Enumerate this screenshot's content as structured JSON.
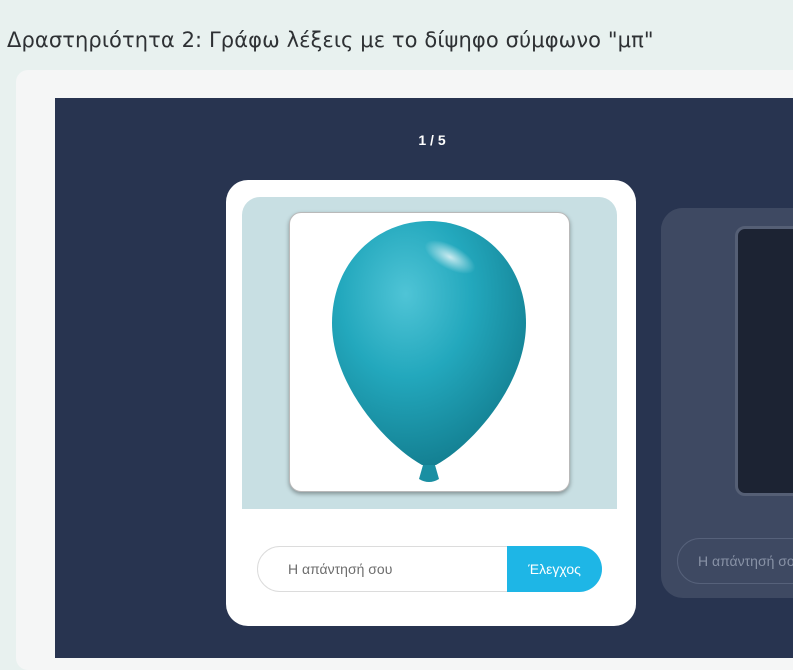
{
  "activity": {
    "title": "Δραστηριότητα 2: Γράφω λέξεις με το δίψηφο σύμφωνο \"μπ\""
  },
  "slider": {
    "counter": "1 / 5"
  },
  "cards": [
    {
      "image": "balloon",
      "answer_value": "",
      "answer_placeholder": "Η απάντησή σου",
      "check_label": "Έλεγχος"
    },
    {
      "image": "dark-photo",
      "answer_value": "",
      "answer_placeholder": "Η απάντησή σου"
    }
  ],
  "colors": {
    "stage_bg": "#283450",
    "accent": "#1eb6e6",
    "balloon": "#1a9fb3"
  }
}
